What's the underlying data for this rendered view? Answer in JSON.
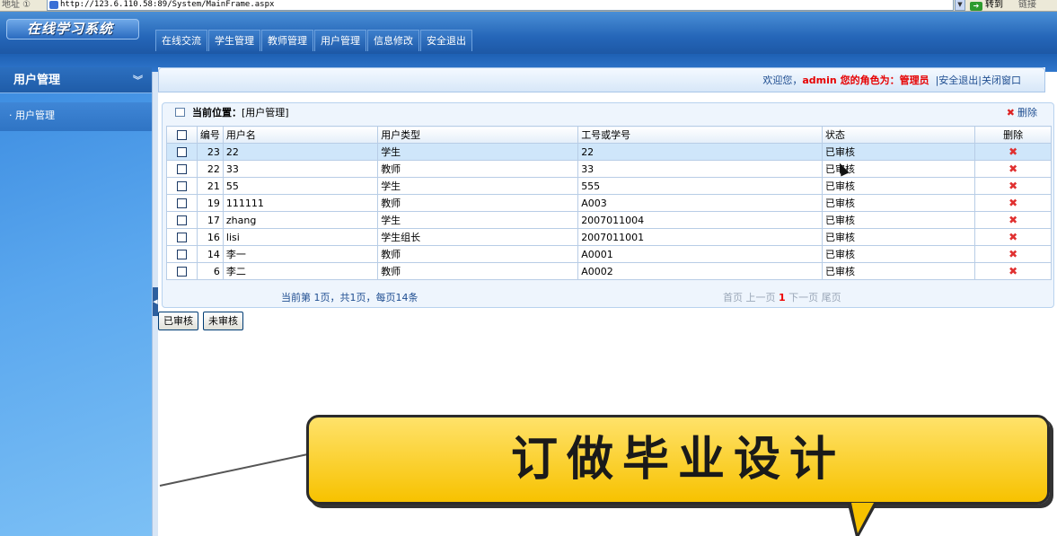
{
  "browser": {
    "address_label": "地址 ①",
    "url": "http://123.6.110.58:89/System/MainFrame.aspx",
    "go_label": "转到",
    "links_label": "链接"
  },
  "header": {
    "logo": "在线学习系统",
    "nav": [
      "在线交流",
      "学生管理",
      "教师管理",
      "用户管理",
      "信息修改",
      "安全退出"
    ]
  },
  "sidebar": {
    "title": "用户管理",
    "items": [
      "用户管理"
    ]
  },
  "welcome": {
    "greeting": "欢迎您，",
    "user": "admin",
    "role_prefix": " 您的角色为：",
    "role": "管理员",
    "logout": "安全退出",
    "close": "关闭窗口"
  },
  "panel": {
    "location_label": "当前位置：",
    "location_value": "[用户管理]",
    "delete_label": "删除"
  },
  "table": {
    "headers": [
      "编号",
      "用户名",
      "用户类型",
      "工号或学号",
      "状态",
      "删除"
    ],
    "rows": [
      {
        "id": "23",
        "name": "22",
        "type": "学生",
        "no": "22",
        "status": "已审核"
      },
      {
        "id": "22",
        "name": "33",
        "type": "教师",
        "no": "33",
        "status": "已审核"
      },
      {
        "id": "21",
        "name": "55",
        "type": "学生",
        "no": "555",
        "status": "已审核"
      },
      {
        "id": "19",
        "name": "111111",
        "type": "教师",
        "no": "A003",
        "status": "已审核"
      },
      {
        "id": "17",
        "name": "zhang",
        "type": "学生",
        "no": "2007011004",
        "status": "已审核"
      },
      {
        "id": "16",
        "name": "lisi",
        "type": "学生组长",
        "no": "2007011001",
        "status": "已审核"
      },
      {
        "id": "14",
        "name": "李一",
        "type": "教师",
        "no": "A0001",
        "status": "已审核"
      },
      {
        "id": "6",
        "name": "李二",
        "type": "教师",
        "no": "A0002",
        "status": "已审核"
      }
    ]
  },
  "pager": {
    "info": "当前第 1页，共1页，每页14条",
    "first": "首页",
    "prev": "上一页",
    "current": "1",
    "next": "下一页",
    "last": "尾页"
  },
  "buttons": {
    "approved": "已审核",
    "unapproved": "未审核"
  },
  "banner": {
    "text": "订做毕业设计"
  },
  "colors": {
    "header_blue": "#2566b8",
    "accent_red": "#e60000",
    "banner_yellow": "#f7c200"
  }
}
